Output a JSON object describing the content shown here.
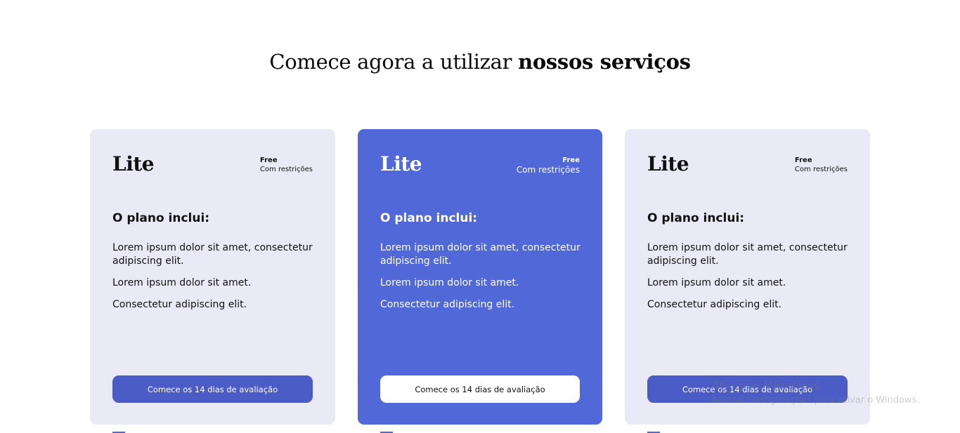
{
  "headline": {
    "normal": "Comece agora a utilizar ",
    "bold": "nossos serviços"
  },
  "cards": [
    {
      "plan_name": "Lite",
      "price": "Free",
      "price_note": "Com restrições",
      "includes_title": "O plano inclui:",
      "features": [
        "Lorem ipsum dolor sit amet, consectetur adipiscing elit.",
        "Lorem ipsum dolor sit amet.",
        "Consectetur adipiscing elit."
      ],
      "cta_label": "Comece os 14 dias de avaliação"
    },
    {
      "plan_name": "Lite",
      "price": "Free",
      "price_note": "Com restrições",
      "includes_title": "O plano inclui:",
      "features": [
        "Lorem ipsum dolor sit amet, consectetur adipiscing elit.",
        "Lorem ipsum dolor sit amet.",
        "Consectetur adipiscing elit."
      ],
      "cta_label": "Comece os 14 dias de avaliação"
    },
    {
      "plan_name": "Lite",
      "price": "Free",
      "price_note": "Com restrições",
      "includes_title": "O plano inclui:",
      "features": [
        "Lorem ipsum dolor sit amet, consectetur adipiscing elit.",
        "Lorem ipsum dolor sit amet.",
        "Consectetur adipiscing elit."
      ],
      "cta_label": "Comece os 14 dias de avaliação"
    }
  ],
  "watermark": {
    "title": "Ativar o Windows",
    "subtitle": "Acesse Configurações para ativar o Windows."
  },
  "colors": {
    "card_bg": "#eaeaf6",
    "featured_card_bg": "#5068d8",
    "button_bg": "#4b5cc6",
    "accent": "#5068d8"
  }
}
